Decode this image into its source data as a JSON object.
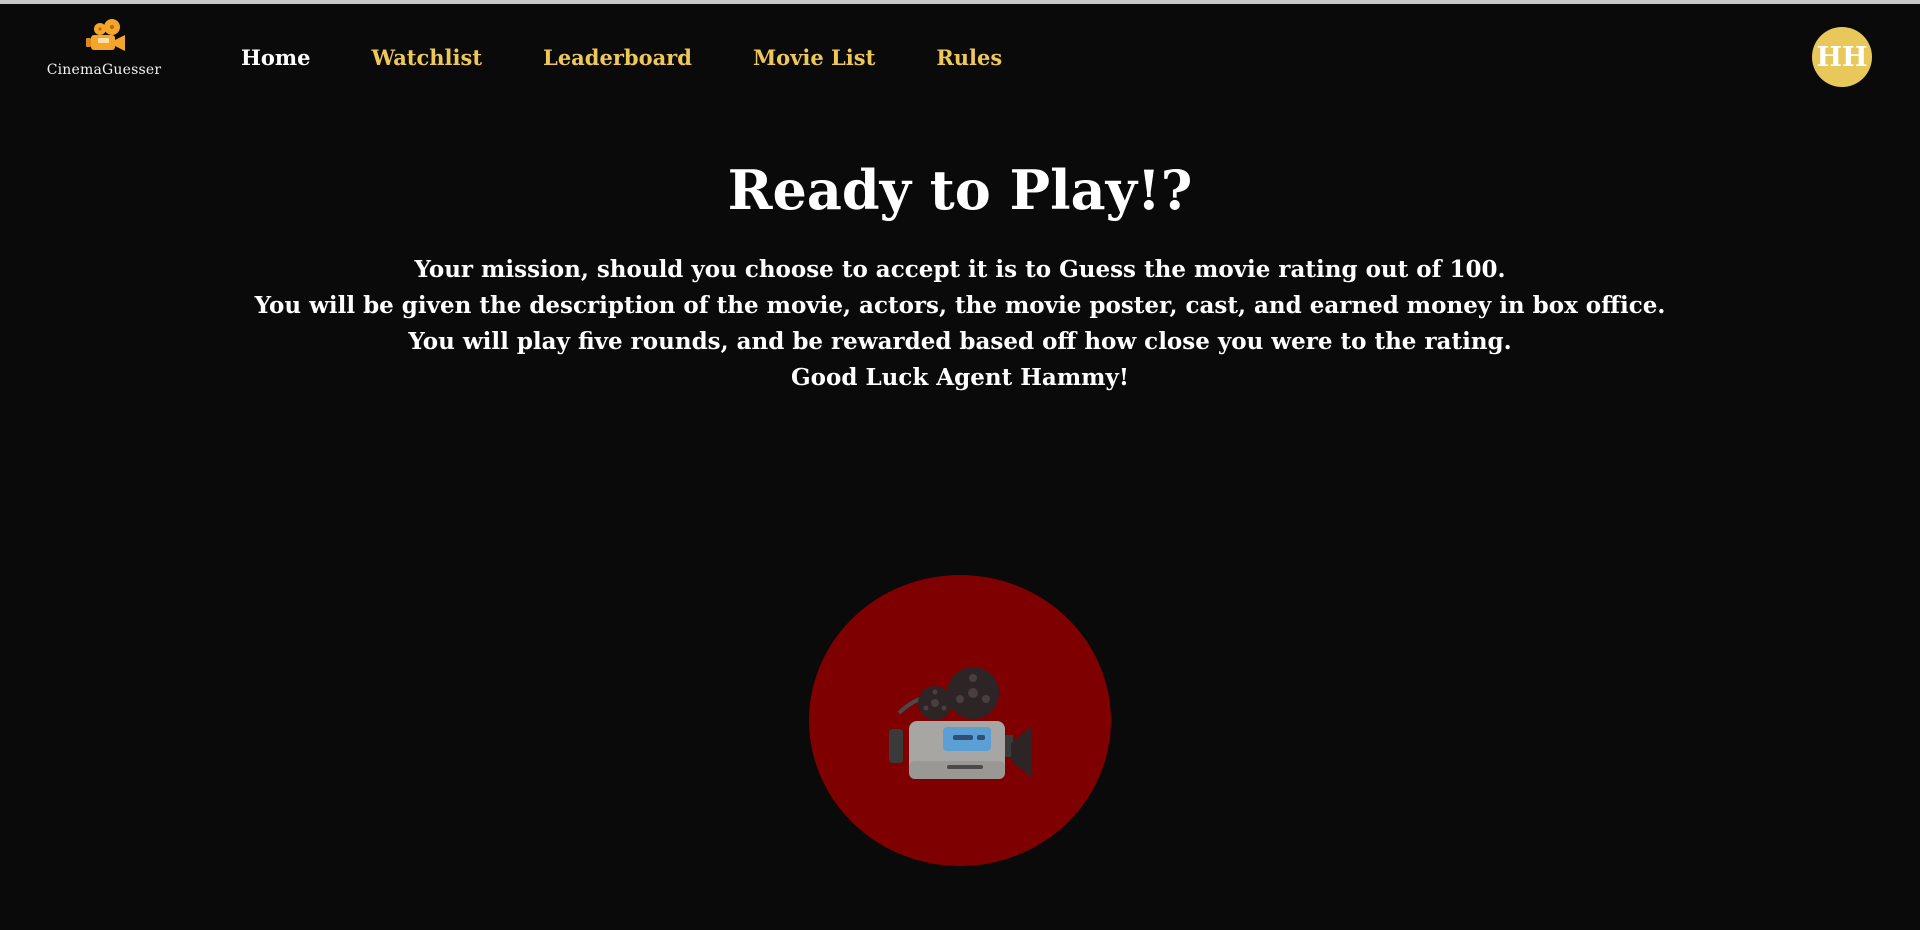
{
  "brand": {
    "name": "CinemaGuesser",
    "icon": "movie-camera-icon",
    "icon_color": "#f4a62a"
  },
  "nav": {
    "items": [
      {
        "label": "Home",
        "active": true
      },
      {
        "label": "Watchlist",
        "active": false
      },
      {
        "label": "Leaderboard",
        "active": false
      },
      {
        "label": "Movie List",
        "active": false
      },
      {
        "label": "Rules",
        "active": false
      }
    ],
    "active_color": "#ffffff",
    "link_color": "#eec75a"
  },
  "user": {
    "initials": "HH",
    "avatar_color": "#e8c85a"
  },
  "hero": {
    "title": "Ready to Play!?",
    "lines": [
      "Your mission, should you choose to accept it is to Guess the movie rating out of 100.",
      "You will be given the description of the movie, actors, the movie poster, cast, and earned money in box office.",
      "You will play five rounds, and be rewarded based off how close you were to the rating.",
      "Good Luck Agent Hammy!"
    ]
  },
  "play_button": {
    "icon": "movie-camera-icon",
    "background": "#7e0000"
  },
  "colors": {
    "background": "#0a0a0a",
    "accent": "#eec75a"
  }
}
